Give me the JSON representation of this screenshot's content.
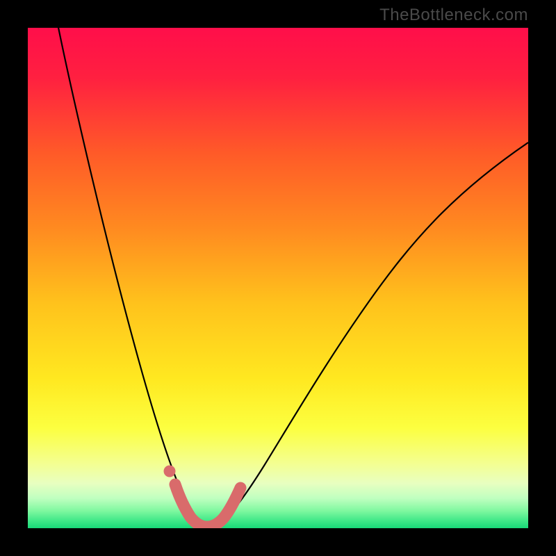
{
  "watermark": "TheBottleneck.com",
  "chart_data": {
    "type": "line",
    "title": "",
    "xlabel": "",
    "ylabel": "",
    "xlim": [
      0,
      100
    ],
    "ylim": [
      0,
      100
    ],
    "series": [
      {
        "name": "bottleneck-curve",
        "x": [
          5,
          10,
          15,
          20,
          25,
          27,
          29,
          31,
          33,
          35,
          37,
          40,
          45,
          50,
          55,
          60,
          70,
          80,
          90,
          100
        ],
        "y": [
          100,
          80,
          60,
          40,
          20,
          12,
          6,
          2,
          0,
          0,
          2,
          6,
          15,
          25,
          35,
          44,
          58,
          68,
          76,
          82
        ]
      }
    ],
    "annotations": [
      {
        "name": "optimal-zone-marker",
        "x_range": [
          28,
          38
        ],
        "y": 3,
        "style": "thick-pink-dotted"
      }
    ],
    "background": {
      "type": "vertical-gradient",
      "stops": [
        {
          "pos": 0,
          "color": "#ff1050"
        },
        {
          "pos": 0.25,
          "color": "#ff5030"
        },
        {
          "pos": 0.5,
          "color": "#ffb020"
        },
        {
          "pos": 0.7,
          "color": "#ffe820"
        },
        {
          "pos": 0.85,
          "color": "#f8ff60"
        },
        {
          "pos": 0.92,
          "color": "#e0ffb0"
        },
        {
          "pos": 0.96,
          "color": "#90ffb0"
        },
        {
          "pos": 1,
          "color": "#20e080"
        }
      ]
    }
  }
}
